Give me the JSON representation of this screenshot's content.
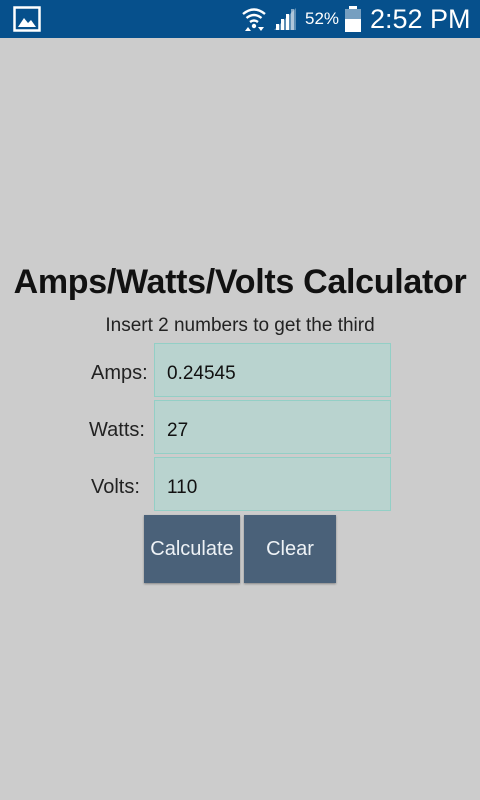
{
  "status_bar": {
    "battery_percent": "52%",
    "time": "2:52 PM",
    "icons": [
      "gallery-icon",
      "wifi-icon",
      "signal-icon",
      "battery-icon"
    ]
  },
  "main": {
    "title": "Amps/Watts/Volts Calculator",
    "subtitle": "Insert 2 numbers to get the third",
    "fields": [
      {
        "label": "Amps:",
        "value": "0.24545"
      },
      {
        "label": "Watts:",
        "value": "27"
      },
      {
        "label": "Volts:",
        "value": "110"
      }
    ],
    "buttons": {
      "calculate": "Calculate",
      "clear": "Clear"
    }
  },
  "colors": {
    "status_bar": "#06508c",
    "background": "#cccccc",
    "field_bg": "#b9d3cf",
    "field_border": "#93cfc6",
    "button_bg": "#4a6179"
  }
}
